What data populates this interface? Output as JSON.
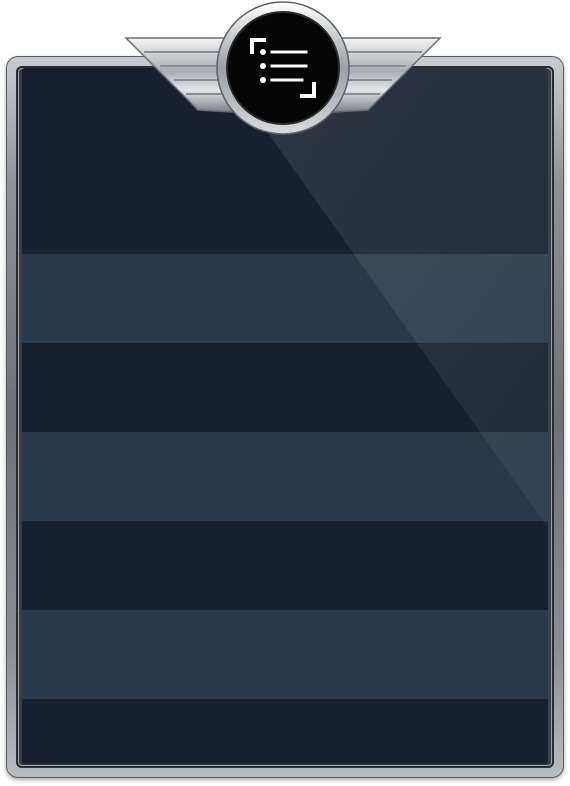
{
  "emblem": {
    "icon": "checklist-icon"
  },
  "panel": {
    "stripe_count": 8
  },
  "colors": {
    "stripe_dark": "#17202c",
    "stripe_light": "#29394a",
    "frame": "#7d8186",
    "emblem_bg": "#000000"
  }
}
